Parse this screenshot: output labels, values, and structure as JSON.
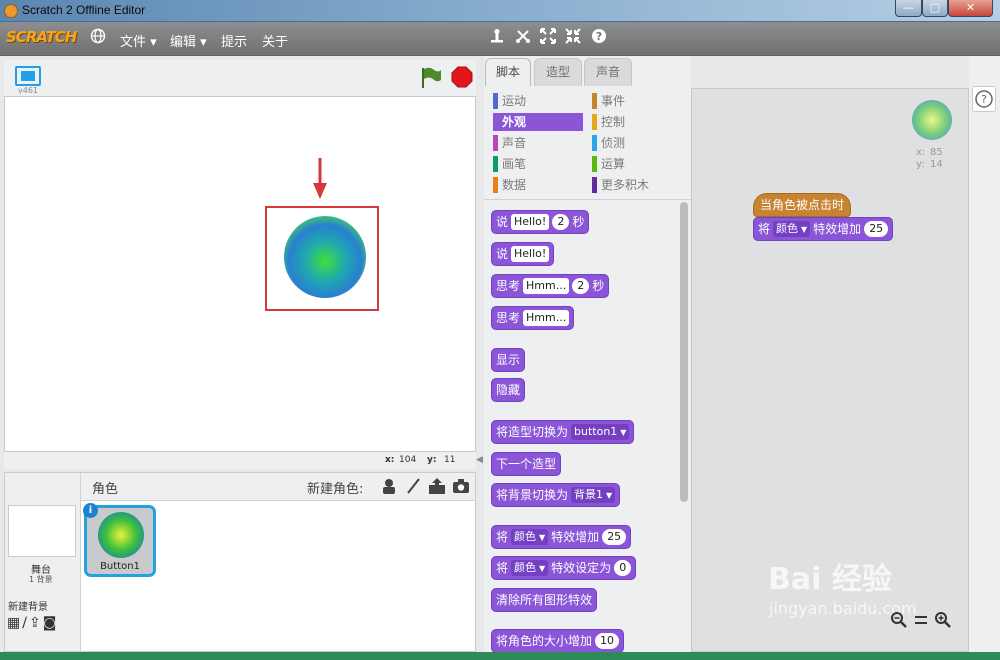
{
  "window": {
    "title": "Scratch 2 Offline Editor",
    "buttons": {
      "minimize": "—",
      "maximize": "□",
      "close": "✕"
    }
  },
  "menubar": {
    "logo": "SCRATCH",
    "items": [
      "文件 ▾",
      "编辑 ▾",
      "提示",
      "关于"
    ],
    "tool_icons": [
      "duplicate-icon",
      "cut-icon",
      "grow-icon",
      "shrink-icon",
      "help-icon"
    ]
  },
  "stage": {
    "version": "v461",
    "mouse_x_label": "x:",
    "mouse_x": "104",
    "mouse_y_label": "y:",
    "mouse_y": "11"
  },
  "sprites": {
    "header": "角色",
    "new_sprite_label": "新建角色:",
    "stage_label": "舞台",
    "stage_backdrops": "1 背景",
    "new_backdrop_label": "新建背景",
    "selected_sprite": "Button1",
    "info_badge": "i"
  },
  "palette": {
    "tabs": [
      "脚本",
      "造型",
      "声音"
    ],
    "categories": [
      {
        "label": "运动",
        "color": "#4a6cd4"
      },
      {
        "label": "事件",
        "color": "#c88330"
      },
      {
        "label": "外观",
        "color": "#8a55d7"
      },
      {
        "label": "控制",
        "color": "#e1a91a"
      },
      {
        "label": "声音",
        "color": "#bb42c3"
      },
      {
        "label": "侦测",
        "color": "#2ca5e2"
      },
      {
        "label": "画笔",
        "color": "#0e9a6c"
      },
      {
        "label": "运算",
        "color": "#5cb712"
      },
      {
        "label": "数据",
        "color": "#ee7d16"
      },
      {
        "label": "更多积木",
        "color": "#632d99"
      }
    ],
    "blocks": {
      "say_secs": {
        "text": "说",
        "input": "Hello!",
        "num": "2",
        "tail": "秒"
      },
      "say": {
        "text": "说",
        "input": "Hello!"
      },
      "think_secs": {
        "text": "思考",
        "input": "Hmm...",
        "num": "2",
        "tail": "秒"
      },
      "think": {
        "text": "思考",
        "input": "Hmm..."
      },
      "show": {
        "text": "显示"
      },
      "hide": {
        "text": "隐藏"
      },
      "switch_costume": {
        "text": "将造型切换为",
        "drop": "button1"
      },
      "next_costume": {
        "text": "下一个造型"
      },
      "switch_backdrop": {
        "text": "将背景切换为",
        "drop": "背景1"
      },
      "change_effect": {
        "text": "将",
        "drop": "颜色",
        "tail": "特效增加",
        "num": "25"
      },
      "set_effect": {
        "text": "将",
        "drop": "颜色",
        "tail": "特效设定为",
        "num": "0"
      },
      "clear_effects": {
        "text": "清除所有图形特效"
      },
      "change_size": {
        "text": "将角色的大小增加",
        "num": "10"
      }
    }
  },
  "script": {
    "sprite_x_label": "x:",
    "sprite_x": "85",
    "sprite_y_label": "y:",
    "sprite_y": "14",
    "hat_block": "当角色被点击时",
    "effect_block": {
      "text": "将",
      "drop": "颜色",
      "tail": "特效增加",
      "num": "25"
    }
  },
  "watermark": {
    "brand": "Bai 经验",
    "url": "jingyan.baidu.com"
  },
  "colors": {
    "looks_purple": "#8a55d7",
    "events_orange": "#c88330",
    "highlight_red": "#d4383a"
  }
}
